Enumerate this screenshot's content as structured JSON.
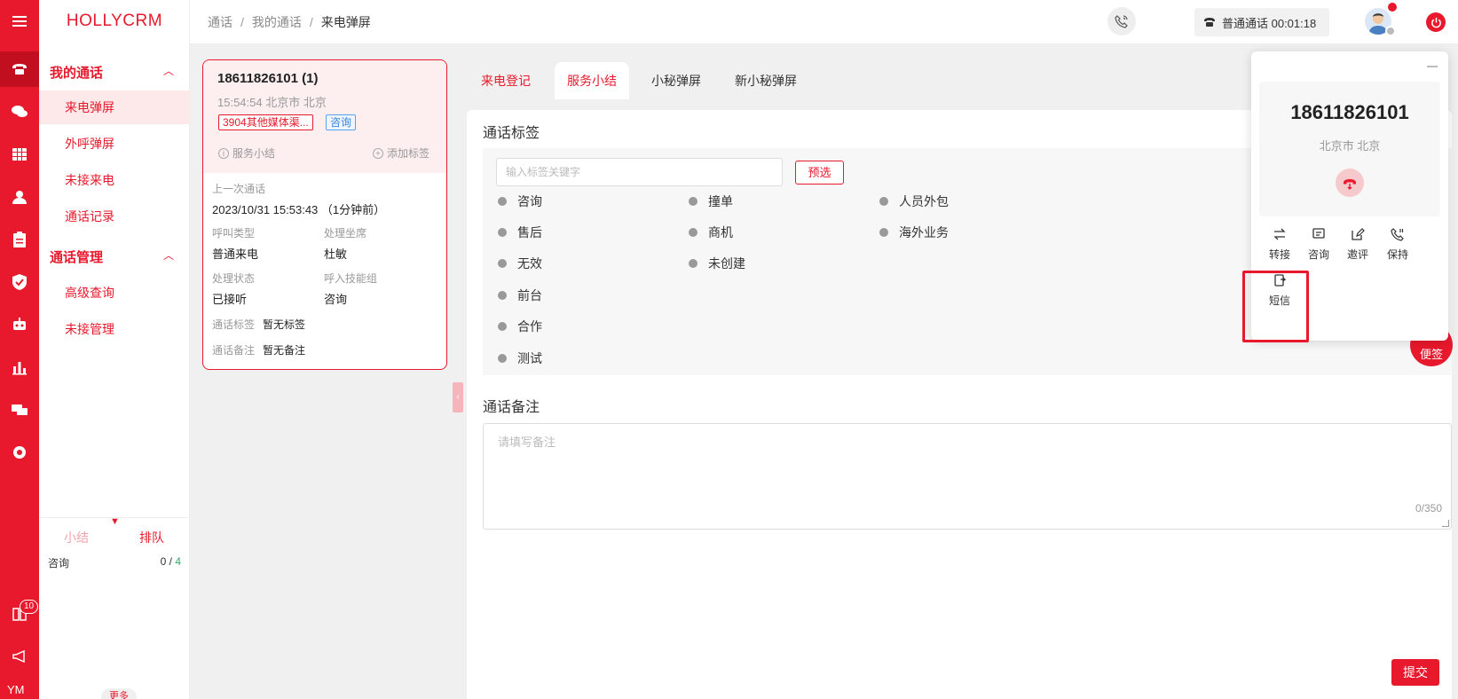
{
  "brand": "HOLLYCRM",
  "rail": {
    "badge_count": "10",
    "bottom_text": "YM"
  },
  "nav": {
    "group1": "我的通话",
    "group1_items": [
      "来电弹屏",
      "外呼弹屏",
      "未接来电",
      "通话记录"
    ],
    "group2": "通话管理",
    "group2_items": [
      "高级查询",
      "未接管理"
    ],
    "bottom_tabs": [
      "小结",
      "排队"
    ],
    "queue_name": "咨询",
    "queue_count_a": "0 / ",
    "queue_count_b": "4",
    "more": "更多"
  },
  "header": {
    "breadcrumb": [
      "通话",
      "我的通话",
      "来电弹屏"
    ],
    "breadcrumb_sep": "/",
    "call_status": "普通通话 00:01:18"
  },
  "card": {
    "number": "18611826101 (1)",
    "time_location": "15:54:54 北京市 北京",
    "tag_red": "3904其他媒体渠...",
    "tag_blue": "咨询",
    "action_summary": "服务小结",
    "action_add_tag": "添加标签",
    "last_call_label": "上一次通话",
    "last_call_value": "2023/10/31 15:53:43 （1分钟前）",
    "call_type_label": "呼叫类型",
    "call_type_value": "普通来电",
    "agent_label": "处理坐席",
    "agent_value": "杜敏",
    "status_label": "处理状态",
    "status_value": "已接听",
    "skill_label": "呼入技能组",
    "skill_value": "咨询",
    "tag_label": "通话标签",
    "tag_value": "暂无标签",
    "remark_label": "通话备注",
    "remark_value": "暂无备注"
  },
  "tabs": [
    "来电登记",
    "服务小结",
    "小秘弹屏",
    "新小秘弹屏"
  ],
  "main": {
    "tag_title": "通话标签",
    "tag_input_placeholder": "输入标签关键字",
    "preselect": "预选",
    "options_col1": [
      "咨询",
      "售后",
      "无效",
      "前台",
      "合作",
      "测试"
    ],
    "options_col2": [
      "撞单",
      "商机",
      "未创建"
    ],
    "options_col3": [
      "人员外包",
      "海外业务"
    ],
    "remark_title": "通话备注",
    "remark_placeholder": "请填写备注",
    "remark_count": "0/350",
    "submit": "提交"
  },
  "note_fab": "便签",
  "popup": {
    "number": "18611826101",
    "location": "北京市 北京",
    "actions": [
      "转接",
      "咨询",
      "邀评",
      "保持",
      "短信"
    ]
  },
  "colors": {
    "accent": "#e8192c",
    "accent_dark": "#c10f20",
    "accent_light": "#fde8ea",
    "success": "#2eaa6a",
    "info": "#3a86e0"
  }
}
